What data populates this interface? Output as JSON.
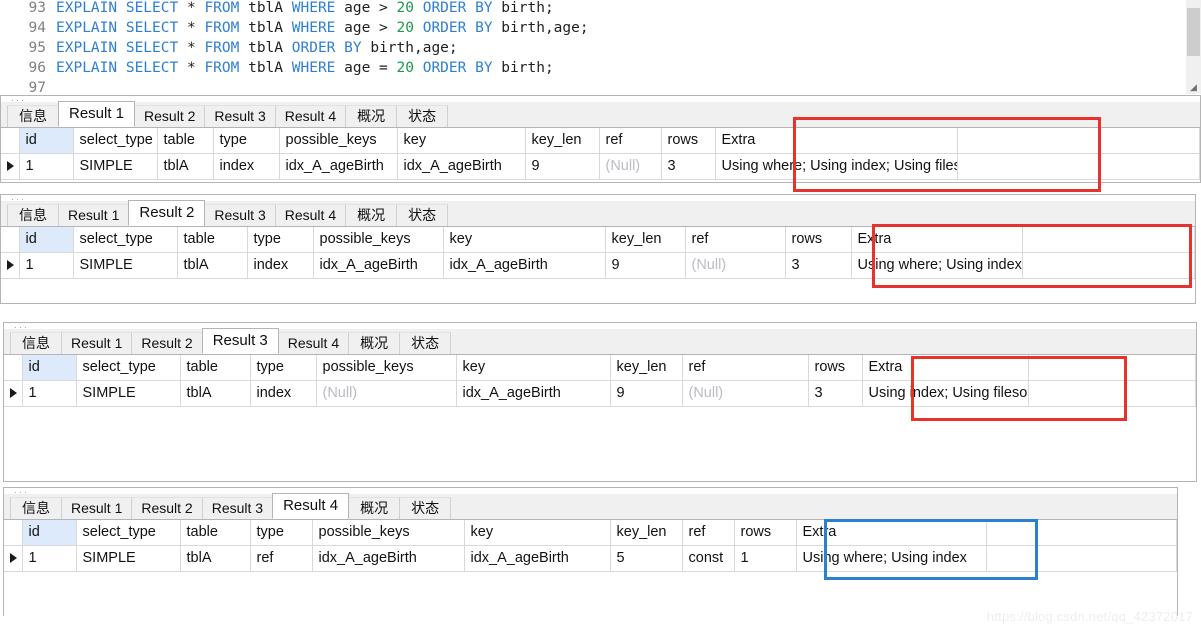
{
  "editor": {
    "lines": [
      {
        "num": "93",
        "tokens": [
          {
            "t": "EXPLAIN",
            "c": "kw"
          },
          {
            "t": " ",
            "c": "plain"
          },
          {
            "t": "SELECT",
            "c": "kw"
          },
          {
            "t": " * ",
            "c": "plain"
          },
          {
            "t": "FROM",
            "c": "kw"
          },
          {
            "t": " tblA ",
            "c": "plain"
          },
          {
            "t": "WHERE",
            "c": "kw"
          },
          {
            "t": " age > ",
            "c": "plain"
          },
          {
            "t": "20",
            "c": "num"
          },
          {
            "t": " ",
            "c": "plain"
          },
          {
            "t": "ORDER",
            "c": "kw"
          },
          {
            "t": " ",
            "c": "plain"
          },
          {
            "t": "BY",
            "c": "kw"
          },
          {
            "t": " birth;",
            "c": "plain"
          }
        ]
      },
      {
        "num": "94",
        "tokens": [
          {
            "t": "EXPLAIN",
            "c": "kw"
          },
          {
            "t": " ",
            "c": "plain"
          },
          {
            "t": "SELECT",
            "c": "kw"
          },
          {
            "t": " * ",
            "c": "plain"
          },
          {
            "t": "FROM",
            "c": "kw"
          },
          {
            "t": " tblA ",
            "c": "plain"
          },
          {
            "t": "WHERE",
            "c": "kw"
          },
          {
            "t": " age > ",
            "c": "plain"
          },
          {
            "t": "20",
            "c": "num"
          },
          {
            "t": " ",
            "c": "plain"
          },
          {
            "t": "ORDER",
            "c": "kw"
          },
          {
            "t": " ",
            "c": "plain"
          },
          {
            "t": "BY",
            "c": "kw"
          },
          {
            "t": " birth,age;",
            "c": "plain"
          }
        ]
      },
      {
        "num": "95",
        "tokens": [
          {
            "t": "EXPLAIN",
            "c": "kw"
          },
          {
            "t": " ",
            "c": "plain"
          },
          {
            "t": "SELECT",
            "c": "kw"
          },
          {
            "t": " * ",
            "c": "plain"
          },
          {
            "t": "FROM",
            "c": "kw"
          },
          {
            "t": " tblA ",
            "c": "plain"
          },
          {
            "t": "ORDER",
            "c": "kw"
          },
          {
            "t": " ",
            "c": "plain"
          },
          {
            "t": "BY",
            "c": "kw"
          },
          {
            "t": " birth,age;",
            "c": "plain"
          }
        ]
      },
      {
        "num": "96",
        "tokens": [
          {
            "t": "EXPLAIN",
            "c": "kw"
          },
          {
            "t": " ",
            "c": "plain"
          },
          {
            "t": "SELECT",
            "c": "kw"
          },
          {
            "t": " * ",
            "c": "plain"
          },
          {
            "t": "FROM",
            "c": "kw"
          },
          {
            "t": " tblA ",
            "c": "plain"
          },
          {
            "t": "WHERE",
            "c": "kw"
          },
          {
            "t": " age = ",
            "c": "plain"
          },
          {
            "t": "20",
            "c": "num"
          },
          {
            "t": " ",
            "c": "plain"
          },
          {
            "t": "ORDER",
            "c": "kw"
          },
          {
            "t": " ",
            "c": "plain"
          },
          {
            "t": "BY",
            "c": "kw"
          },
          {
            "t": " birth;",
            "c": "plain"
          }
        ]
      },
      {
        "num": "97",
        "tokens": []
      }
    ],
    "scrollbar_grip": "◢"
  },
  "tabs": [
    "信息",
    "Result 1",
    "Result 2",
    "Result 3",
    "Result 4",
    "概况",
    "状态"
  ],
  "columns": [
    "id",
    "select_type",
    "table",
    "type",
    "possible_keys",
    "key",
    "key_len",
    "ref",
    "rows",
    "Extra"
  ],
  "panels": [
    {
      "active_tab_index": 1,
      "row": [
        "1",
        "SIMPLE",
        "tblA",
        "index",
        "idx_A_ageBirth",
        "idx_A_ageBirth",
        "9",
        "(Null)",
        "3",
        "Using where; Using index; Using filesort"
      ],
      "highlight_color": "#e8322c"
    },
    {
      "active_tab_index": 2,
      "row": [
        "1",
        "SIMPLE",
        "tblA",
        "index",
        "idx_A_ageBirth",
        "idx_A_ageBirth",
        "9",
        "(Null)",
        "3",
        "Using where; Using index; Using filesort"
      ],
      "highlight_color": "#e8322c"
    },
    {
      "active_tab_index": 3,
      "row": [
        "1",
        "SIMPLE",
        "tblA",
        "index",
        "(Null)",
        "idx_A_ageBirth",
        "9",
        "(Null)",
        "3",
        "Using index; Using filesort"
      ],
      "highlight_color": "#e8322c"
    },
    {
      "active_tab_index": 4,
      "row": [
        "1",
        "SIMPLE",
        "tblA",
        "ref",
        "idx_A_ageBirth",
        "idx_A_ageBirth",
        "5",
        "const",
        "1",
        "Using where; Using index"
      ],
      "highlight_color": "#2e7fd0"
    }
  ],
  "watermark": "https://blog.csdn.net/qq_42372017"
}
